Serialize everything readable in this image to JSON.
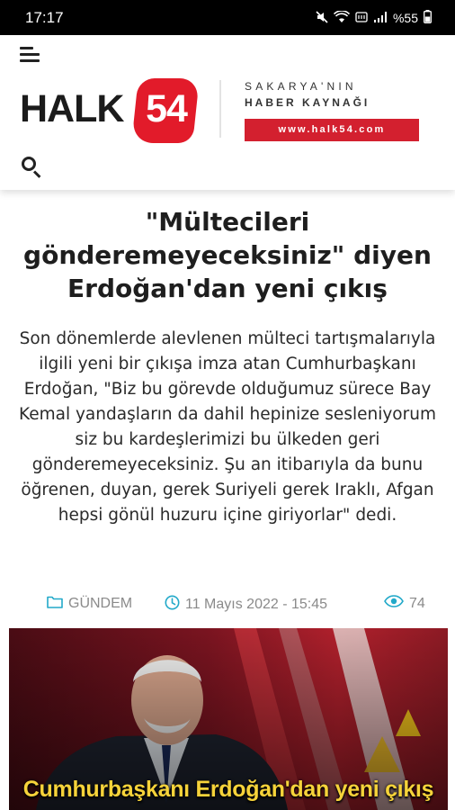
{
  "status_bar": {
    "time": "17:17",
    "battery": "%55"
  },
  "header": {
    "logo_text": "HALK",
    "logo_number": "54",
    "tagline_top": "SAKARYA'NIN",
    "tagline_bottom": "HABER KAYNAĞI",
    "site_url": "www.halk54.com",
    "brand_color": "#e21b2a"
  },
  "article": {
    "title": "\"Mültecileri gönderemeyeceksiniz\" diyen Erdoğan'dan yeni çıkış",
    "summary": "Son dönemlerde alevlenen mülteci tartışmalarıyla ilgili yeni bir çıkışa imza atan Cumhurbaşkanı Erdoğan, \"Biz bu görevde olduğumuz sürece Bay Kemal yandaşların da dahil hepinize sesleniyorum siz bu kardeşlerimizi bu ülkeden geri gönderemeyeceksiniz. Şu an itibarıyla da bunu öğrenen, duyan, gerek Suriyeli gerek Iraklı, Afgan hepsi gönül huzuru içine giriyorlar\" dedi.",
    "category": "GÜNDEM",
    "date": "11 Mayıs 2022 - 15:45",
    "views": "74",
    "meta_icon_color": "#22a9c9",
    "hero_caption": "Cumhurbaşkanı Erdoğan'dan yeni çıkış"
  }
}
